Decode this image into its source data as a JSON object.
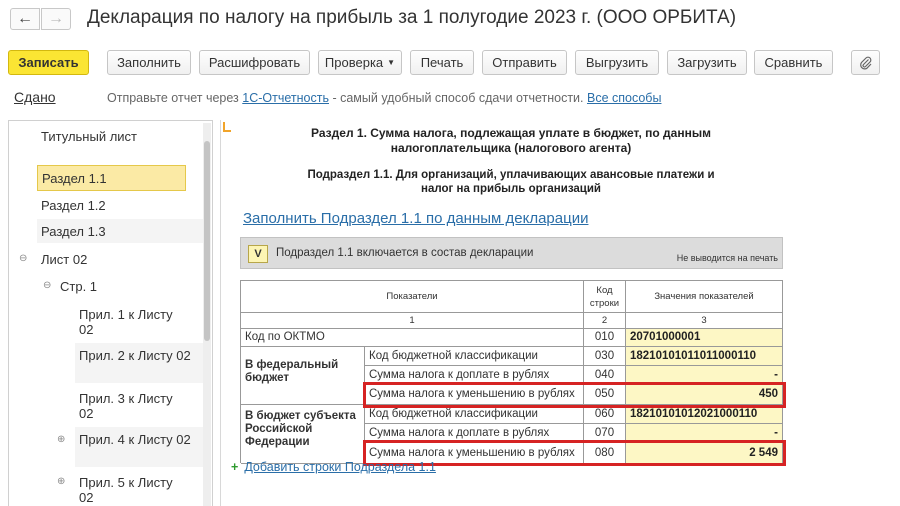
{
  "window": {
    "title": "Декларация по налогу на прибыль за 1 полугодие 2023 г. (ООО ОРБИТА)",
    "back_icon": "arrow-left-icon",
    "forward_icon": "arrow-right-icon"
  },
  "toolbar": {
    "save": "Записать",
    "fill": "Заполнить",
    "decode": "Расшифровать",
    "check": "Проверка",
    "print": "Печать",
    "send": "Отправить",
    "export": "Выгрузить",
    "import": "Загрузить",
    "compare": "Сравнить",
    "attach_icon": "paperclip-icon"
  },
  "info": {
    "status": "Сдано",
    "text_before": "Отправьте отчет через ",
    "link1": "1С-Отчетность",
    "text_after": " - самый удобный способ сдачи отчетности. ",
    "link2": "Все способы"
  },
  "tree": {
    "items": [
      "Титульный лист",
      "Раздел 1.1",
      "Раздел 1.2",
      "Раздел 1.3",
      "Лист 02",
      "Стр. 1",
      "Прил. 1 к Листу 02",
      "Прил. 2 к Листу 02",
      "Прил. 3 к Листу 02",
      "Прил. 4 к Листу 02",
      "Прил. 5 к Листу 02"
    ]
  },
  "doc": {
    "heading1": "Раздел 1. Сумма налога, подлежащая уплате в бюджет, по данным налогоплательщика (налогового агента)",
    "heading2": "Подраздел 1.1. Для организаций, уплачивающих авансовые платежи и налог на прибыль организаций",
    "fill_link": "Заполнить Подраздел 1.1 по данным декларации",
    "include_checkbox": "V",
    "include_text": "Подраздел 1.1 включается в состав декларации",
    "not_printed": "Не выводится на печать",
    "table": {
      "headers": [
        "Показатели",
        "Код строки",
        "Значения показателей"
      ],
      "header_nums": [
        "1",
        "2",
        "3"
      ],
      "oktmo_label": "Код по ОКТМО",
      "group1": "В федеральный бюджет",
      "group2": "В бюджет субъекта Российской Федерации",
      "rows": [
        {
          "label": "Код бюджетной классификации",
          "code": "030",
          "value": "18210101011011000110"
        },
        {
          "label": "Сумма налога к доплате в рублях",
          "code": "040",
          "value": "-"
        },
        {
          "label": "Сумма налога к уменьшению в рублях",
          "code": "050",
          "value": "450"
        },
        {
          "label": "Код бюджетной классификации",
          "code": "060",
          "value": "18210101012021000110"
        },
        {
          "label": "Сумма налога к доплате в рублях",
          "code": "070",
          "value": "-"
        },
        {
          "label": "Сумма налога к уменьшению в рублях",
          "code": "080",
          "value": "2 549"
        }
      ],
      "oktmo_code": "010",
      "oktmo_value": "20701000001"
    },
    "add_rows": "Добавить строки Подраздела 1.1"
  }
}
